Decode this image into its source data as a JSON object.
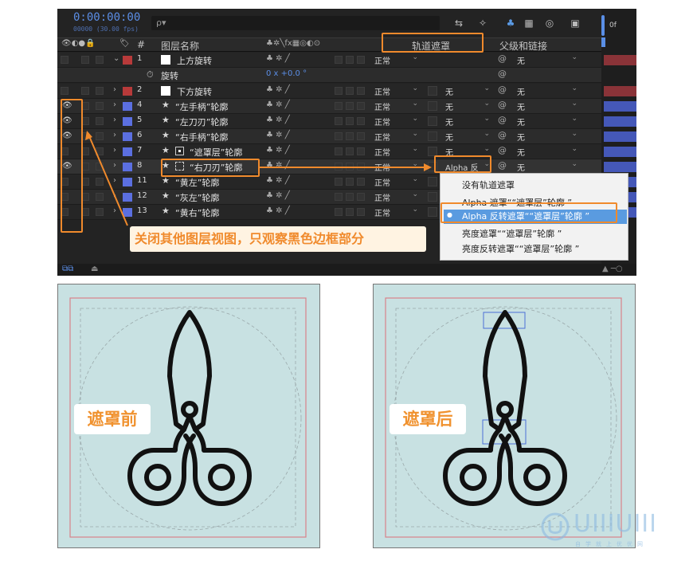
{
  "timeline": {
    "timecode": "0:00:00:00",
    "fps": "00000 (30.00 fps)",
    "search_placeholder": "ρ▾",
    "headers": {
      "layer_name": "图层名称",
      "track_matte": "轨道遮罩",
      "parent_link": "父级和链接",
      "num": "#"
    },
    "layers": [
      {
        "num": "1",
        "name": "上方旋转",
        "mode": "正常",
        "matte": "",
        "parent": "无",
        "color": "#b83a3a",
        "eye": false,
        "expanded": true,
        "kind": "solid"
      },
      {
        "num": "",
        "name": "旋转",
        "mode": "",
        "matte": "",
        "parent": "",
        "color": "",
        "eye": false,
        "expanded": false,
        "kind": "prop",
        "value": "0 x +0.0 °"
      },
      {
        "num": "2",
        "name": "下方旋转",
        "mode": "正常",
        "matte": "无",
        "parent": "无",
        "color": "#b83a3a",
        "eye": false,
        "expanded": false,
        "kind": "solid"
      },
      {
        "num": "4",
        "name": "“左手柄”轮廓",
        "mode": "正常",
        "matte": "无",
        "parent": "无",
        "color": "#5b6fe0",
        "eye": true,
        "expanded": false,
        "kind": "star"
      },
      {
        "num": "5",
        "name": "“左刀刃”轮廓",
        "mode": "正常",
        "matte": "无",
        "parent": "无",
        "color": "#5b6fe0",
        "eye": true,
        "expanded": false,
        "kind": "star"
      },
      {
        "num": "6",
        "name": "“右手柄”轮廓",
        "mode": "正常",
        "matte": "无",
        "parent": "无",
        "color": "#5b6fe0",
        "eye": true,
        "expanded": false,
        "kind": "star"
      },
      {
        "num": "7",
        "name": "“遮罩层”轮廓",
        "mode": "正常",
        "matte": "无",
        "parent": "无",
        "color": "#5b6fe0",
        "eye": false,
        "expanded": false,
        "kind": "star-box"
      },
      {
        "num": "8",
        "name": "“右刀刃”轮廓",
        "mode": "正常",
        "matte": "Alpha 反",
        "parent": "无",
        "color": "#5b6fe0",
        "eye": true,
        "expanded": false,
        "kind": "star-dash"
      },
      {
        "num": "11",
        "name": "“黄左”轮廓",
        "mode": "正常",
        "matte": "无",
        "parent": "无",
        "color": "#5b6fe0",
        "eye": false,
        "expanded": false,
        "kind": "star"
      },
      {
        "num": "12",
        "name": "“灰左”轮廓",
        "mode": "正常",
        "matte": "无",
        "parent": "无",
        "color": "#5b6fe0",
        "eye": false,
        "expanded": false,
        "kind": "star"
      },
      {
        "num": "13",
        "name": "“黄右”轮廓",
        "mode": "正常",
        "matte": "无",
        "parent": "无",
        "color": "#5b6fe0",
        "eye": false,
        "expanded": false,
        "kind": "star"
      }
    ],
    "matte_menu": {
      "items": [
        "没有轨道遮罩",
        "Alpha 遮罩““遮罩层”轮廓 ”",
        "Alpha 反转遮罩““遮罩层”轮廓 ”",
        "亮度遮罩““遮罩层”轮廓 ”",
        "亮度反转遮罩““遮罩层”轮廓 ”"
      ],
      "selected_index": 2
    },
    "timeline_label": "0f",
    "callout": "关闭其他图层视图，只观察黑色边框部分"
  },
  "compare": {
    "before_label": "遮罩前",
    "after_label": "遮罩后",
    "bg_color": "#c8e1e2"
  },
  "watermark": {
    "text": "UIIIUIII",
    "sub": "自学就上优优网"
  },
  "colors": {
    "accent": "#f08a2c",
    "panel": "#232323",
    "highlight": "#5a9be0"
  }
}
